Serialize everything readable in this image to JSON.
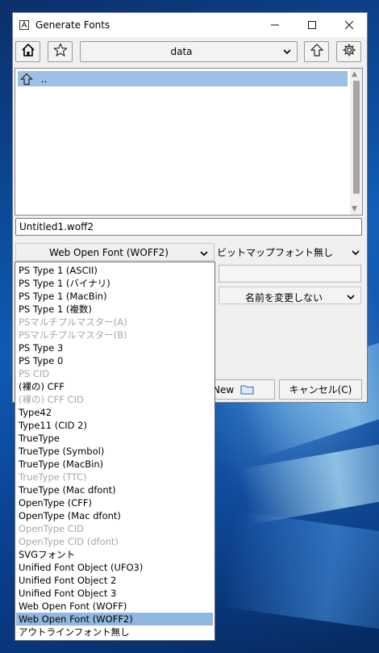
{
  "window": {
    "title": "Generate Fonts",
    "minimize": "—",
    "maximize": "☐",
    "close": "✕"
  },
  "toolbar": {
    "home_icon": "home-icon",
    "bookmark_icon": "star-icon",
    "path_value": "data",
    "parent_icon": "up-arrow-icon",
    "settings_icon": "gear-icon"
  },
  "filelist": {
    "items": [
      {
        "label": ".."
      }
    ]
  },
  "filename": "Untitled1.woff2",
  "format_select": "Web Open Font (WOFF2)",
  "bitmap_select": "ビットマップフォント無し",
  "rename_select": "名前を変更しない",
  "buttons": {
    "new_label": "New",
    "cancel_label": "キャンセル(C)"
  },
  "format_options": [
    {
      "label": "PS Type 1 (ASCII)",
      "state": "enabled"
    },
    {
      "label": "PS Type 1 (バイナリ)",
      "state": "enabled"
    },
    {
      "label": "PS Type 1 (MacBin)",
      "state": "enabled"
    },
    {
      "label": "PS Type 1 (複数)",
      "state": "enabled"
    },
    {
      "label": "PSマルチプルマスター(A)",
      "state": "disabled"
    },
    {
      "label": "PSマルチプルマスター(B)",
      "state": "disabled"
    },
    {
      "label": "PS Type 3",
      "state": "enabled"
    },
    {
      "label": "PS Type 0",
      "state": "enabled"
    },
    {
      "label": "PS CID",
      "state": "disabled"
    },
    {
      "label": "(裸の) CFF",
      "state": "enabled"
    },
    {
      "label": "(裸の) CFF CID",
      "state": "disabled"
    },
    {
      "label": "Type42",
      "state": "enabled"
    },
    {
      "label": "Type11 (CID 2)",
      "state": "enabled"
    },
    {
      "label": "TrueType",
      "state": "enabled"
    },
    {
      "label": "TrueType (Symbol)",
      "state": "enabled"
    },
    {
      "label": "TrueType (MacBin)",
      "state": "enabled"
    },
    {
      "label": "TrueType (TTC)",
      "state": "disabled"
    },
    {
      "label": "TrueType (Mac dfont)",
      "state": "enabled"
    },
    {
      "label": "OpenType (CFF)",
      "state": "enabled"
    },
    {
      "label": "OpenType (Mac dfont)",
      "state": "enabled"
    },
    {
      "label": "OpenType CID",
      "state": "disabled"
    },
    {
      "label": "OpenType CID (dfont)",
      "state": "disabled"
    },
    {
      "label": "SVGフォント",
      "state": "enabled"
    },
    {
      "label": "Unified Font Object (UFO3)",
      "state": "enabled"
    },
    {
      "label": "Unified Font Object 2",
      "state": "enabled"
    },
    {
      "label": "Unified Font Object 3",
      "state": "enabled"
    },
    {
      "label": "Web Open Font (WOFF)",
      "state": "enabled"
    },
    {
      "label": "Web Open Font (WOFF2)",
      "state": "selected"
    },
    {
      "label": "アウトラインフォント無し",
      "state": "enabled"
    }
  ],
  "colors": {
    "selection": "#90b7e0",
    "disabled_text": "#a8a8a8",
    "desktop": "#0e5bb3"
  }
}
